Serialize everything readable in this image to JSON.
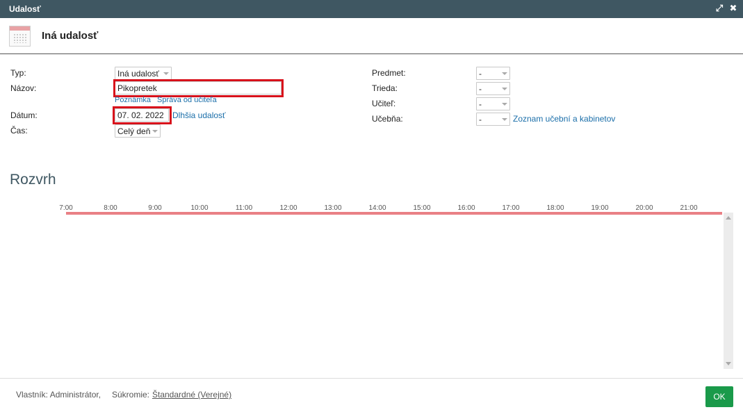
{
  "window": {
    "title": "Udalosť",
    "maximize_icon": "⤢",
    "close_icon": "✖"
  },
  "header": {
    "title": "Iná udalosť",
    "icon": "calendar-icon"
  },
  "form_left": {
    "type_label": "Typ:",
    "type_value": "Iná udalosť",
    "name_label": "Názov:",
    "name_value": "Pikopretek",
    "note_link": "Poznámka",
    "teacher_message_link": "Správa od učiteľa",
    "date_label": "Dátum:",
    "date_value": "07. 02. 2022",
    "longer_event_link": "Dlhšia udalosť",
    "time_label": "Čas:",
    "time_value": "Celý deň"
  },
  "form_right": {
    "subject_label": "Predmet:",
    "subject_value": "-",
    "class_label": "Trieda:",
    "class_value": "-",
    "teacher_label": "Učiteľ:",
    "teacher_value": "-",
    "classroom_label": "Učebňa:",
    "classroom_value": "-",
    "classroom_list_link": "Zoznam učební a kabinetov"
  },
  "schedule": {
    "title": "Rozvrh",
    "hours": [
      "7:00",
      "8:00",
      "9:00",
      "10:00",
      "11:00",
      "12:00",
      "13:00",
      "14:00",
      "15:00",
      "16:00",
      "17:00",
      "18:00",
      "19:00",
      "20:00",
      "21:00"
    ],
    "bar_color": "#e98085"
  },
  "footer": {
    "owner_text": "Vlastník: Administrátor,",
    "privacy_label": "Súkromie:",
    "privacy_value": "Štandardné (Verejné)",
    "ok_label": "OK"
  },
  "colors": {
    "titlebar": "#3f5762",
    "highlight": "#d8111b",
    "ok_button": "#1a9a4a",
    "link": "#1a6ea9"
  }
}
